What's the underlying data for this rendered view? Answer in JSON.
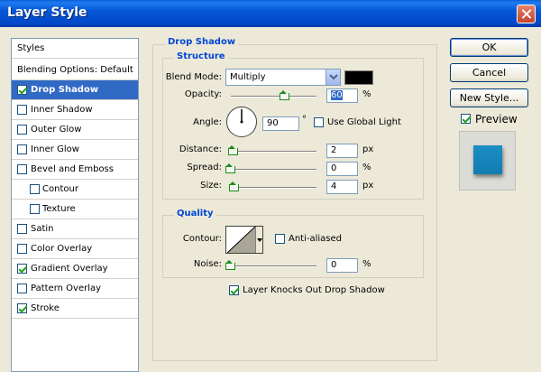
{
  "window": {
    "title": "Layer Style"
  },
  "sidebar": {
    "header": "Styles",
    "blending": "Blending Options: Default",
    "items": [
      {
        "label": "Drop Shadow",
        "checked": true,
        "selected": true
      },
      {
        "label": "Inner Shadow",
        "checked": false
      },
      {
        "label": "Outer Glow",
        "checked": false
      },
      {
        "label": "Inner Glow",
        "checked": false
      },
      {
        "label": "Bevel and Emboss",
        "checked": false
      },
      {
        "label": "Contour",
        "checked": false,
        "sub": true
      },
      {
        "label": "Texture",
        "checked": false,
        "sub": true
      },
      {
        "label": "Satin",
        "checked": false
      },
      {
        "label": "Color Overlay",
        "checked": false
      },
      {
        "label": "Gradient Overlay",
        "checked": true
      },
      {
        "label": "Pattern Overlay",
        "checked": false
      },
      {
        "label": "Stroke",
        "checked": true
      }
    ]
  },
  "drop_shadow": {
    "group_title": "Drop Shadow",
    "structure_title": "Structure",
    "blend_mode_label": "Blend Mode:",
    "blend_mode_value": "Multiply",
    "shadow_color": "#000000",
    "opacity_label": "Opacity:",
    "opacity_value": "60",
    "opacity_unit": "%",
    "angle_label": "Angle:",
    "angle_value": "90",
    "angle_unit": "°",
    "global_light_label": "Use Global Light",
    "global_light_checked": false,
    "distance_label": "Distance:",
    "distance_value": "2",
    "distance_unit": "px",
    "spread_label": "Spread:",
    "spread_value": "0",
    "spread_unit": "%",
    "size_label": "Size:",
    "size_value": "4",
    "size_unit": "px"
  },
  "quality": {
    "title": "Quality",
    "contour_label": "Contour:",
    "anti_aliased_label": "Anti-aliased",
    "anti_aliased_checked": false,
    "noise_label": "Noise:",
    "noise_value": "0",
    "noise_unit": "%",
    "knockout_label": "Layer Knocks Out Drop Shadow",
    "knockout_checked": true
  },
  "buttons": {
    "ok": "OK",
    "cancel": "Cancel",
    "new_style": "New Style...",
    "preview_label": "Preview",
    "preview_checked": true
  },
  "colors": {
    "preview_swatch": "#1a8ec4",
    "selection": "#316ac5",
    "group_title": "#0046d5"
  },
  "icons": {
    "close": "close-icon",
    "dropdown": "chevron-down-icon",
    "angle": "angle-dial-icon",
    "contour": "contour-curve-icon"
  }
}
